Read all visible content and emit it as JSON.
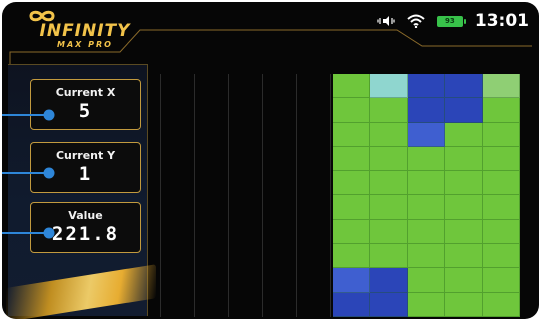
{
  "header": {
    "brand_title": "INFINITY",
    "brand_subtitle": "MAX PRO",
    "battery_level": "93",
    "time": "13:01"
  },
  "readouts": [
    {
      "label": "Current X",
      "value": "5"
    },
    {
      "label": "Current Y",
      "value": "1"
    },
    {
      "label": "Value",
      "value": "221.8"
    }
  ],
  "colors": {
    "accent_gold": "#c29a3e",
    "logo_gold": "#f2c34a",
    "connector_blue": "#2e86d8",
    "heat_green": "#6fc63c",
    "heat_blue": "#3f5fd0",
    "heat_dark_blue": "#2b45b8",
    "heat_light_blue": "#6fb9e8",
    "heat_cyan": "#8fd6cf"
  },
  "heatmap": {
    "columns": 5,
    "rows": 10,
    "cells": [
      [
        "green",
        "cyan",
        "dark_blue",
        "dark_blue",
        "green_light"
      ],
      [
        "green",
        "green",
        "dark_blue",
        "dark_blue",
        "green"
      ],
      [
        "green",
        "green",
        "mid_blue",
        "green",
        "green"
      ],
      [
        "green",
        "green",
        "green",
        "green",
        "green"
      ],
      [
        "green",
        "green",
        "green",
        "green",
        "green"
      ],
      [
        "green",
        "green",
        "green",
        "green",
        "green"
      ],
      [
        "green",
        "green",
        "green",
        "green",
        "green"
      ],
      [
        "green",
        "green",
        "green",
        "green",
        "green"
      ],
      [
        "mid_blue",
        "dark_blue",
        "green",
        "green",
        "green"
      ],
      [
        "dark_blue",
        "dark_blue",
        "green",
        "green",
        "green"
      ]
    ]
  }
}
